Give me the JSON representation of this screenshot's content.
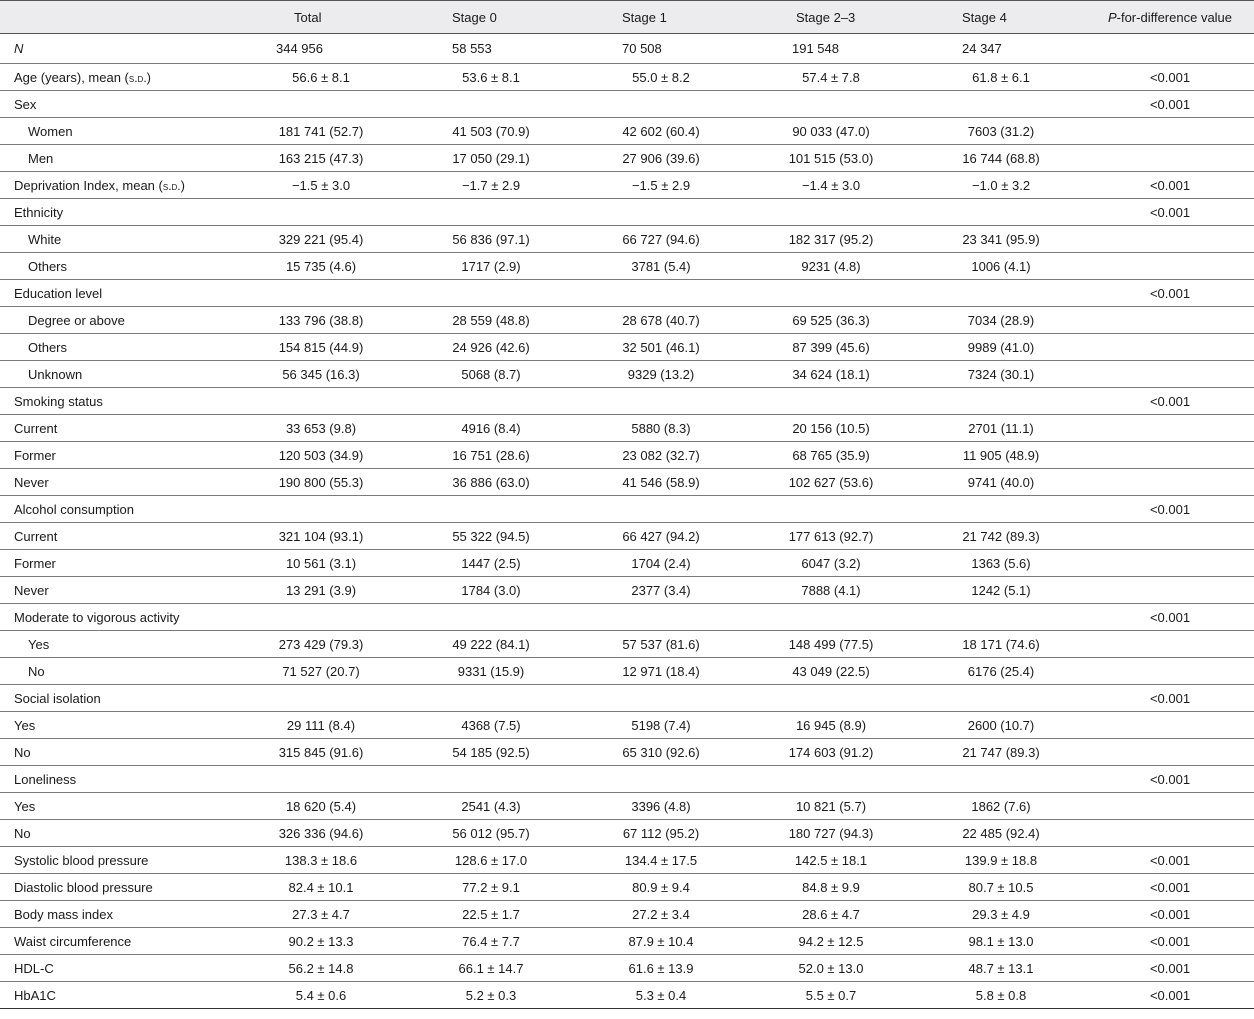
{
  "headers": {
    "col0": "",
    "total": "Total",
    "stage0": "Stage 0",
    "stage1": "Stage 1",
    "stage23": "Stage 2–3",
    "stage4": "Stage 4",
    "p_italic": "P",
    "p_rest": "-for-difference value"
  },
  "n_row": {
    "label": "N",
    "total": "344 956",
    "stage0": "58 553",
    "stage1": "70 508",
    "stage23": "191 548",
    "stage4": "24 347",
    "p": ""
  },
  "age_row": {
    "label_pre": "Age (years), mean (",
    "label_sc": "s.d.",
    "label_post": ")",
    "total": "56.6 ± 8.1",
    "stage0": "53.6 ± 8.1",
    "stage1": "55.0 ± 8.2",
    "stage23": "57.4 ± 7.8",
    "stage4": "61.8 ± 6.1",
    "p": "<0.001"
  },
  "depr_row": {
    "label_pre": "Deprivation Index, mean (",
    "label_sc": "s.d.",
    "label_post": ")",
    "total": "−1.5 ± 3.0",
    "stage0": "−1.7 ± 2.9",
    "stage1": "−1.5 ± 2.9",
    "stage23": "−1.4 ± 3.0",
    "stage4": "−1.0 ± 3.2",
    "p": "<0.001"
  },
  "rows": [
    {
      "label": "Sex",
      "indent": false,
      "total": "",
      "stage0": "",
      "stage1": "",
      "stage23": "",
      "stage4": "",
      "p": "<0.001"
    },
    {
      "label": "Women",
      "indent": true,
      "total": "181 741 (52.7)",
      "stage0": "41 503 (70.9)",
      "stage1": "42 602 (60.4)",
      "stage23": "90 033 (47.0)",
      "stage4": "7603 (31.2)",
      "p": ""
    },
    {
      "label": "Men",
      "indent": true,
      "total": "163 215 (47.3)",
      "stage0": "17 050 (29.1)",
      "stage1": "27 906 (39.6)",
      "stage23": "101 515 (53.0)",
      "stage4": "16 744 (68.8)",
      "p": ""
    },
    {
      "label": "Ethnicity",
      "indent": false,
      "total": "",
      "stage0": "",
      "stage1": "",
      "stage23": "",
      "stage4": "",
      "p": "<0.001"
    },
    {
      "label": "White",
      "indent": true,
      "total": "329 221 (95.4)",
      "stage0": "56 836 (97.1)",
      "stage1": "66 727 (94.6)",
      "stage23": "182 317 (95.2)",
      "stage4": "23 341 (95.9)",
      "p": ""
    },
    {
      "label": "Others",
      "indent": true,
      "total": "15 735 (4.6)",
      "stage0": "1717 (2.9)",
      "stage1": "3781 (5.4)",
      "stage23": "9231 (4.8)",
      "stage4": "1006 (4.1)",
      "p": ""
    },
    {
      "label": "Education level",
      "indent": false,
      "total": "",
      "stage0": "",
      "stage1": "",
      "stage23": "",
      "stage4": "",
      "p": "<0.001"
    },
    {
      "label": "Degree or above",
      "indent": true,
      "total": "133 796 (38.8)",
      "stage0": "28 559 (48.8)",
      "stage1": "28 678 (40.7)",
      "stage23": "69 525 (36.3)",
      "stage4": "7034 (28.9)",
      "p": ""
    },
    {
      "label": "Others",
      "indent": true,
      "total": "154 815 (44.9)",
      "stage0": "24 926 (42.6)",
      "stage1": "32 501 (46.1)",
      "stage23": "87 399 (45.6)",
      "stage4": "9989 (41.0)",
      "p": ""
    },
    {
      "label": "Unknown",
      "indent": true,
      "total": "56 345 (16.3)",
      "stage0": "5068 (8.7)",
      "stage1": "9329 (13.2)",
      "stage23": "34 624 (18.1)",
      "stage4": "7324 (30.1)",
      "p": ""
    },
    {
      "label": "Smoking status",
      "indent": false,
      "total": "",
      "stage0": "",
      "stage1": "",
      "stage23": "",
      "stage4": "",
      "p": "<0.001"
    },
    {
      "label": "Current",
      "indent": false,
      "total": "33 653 (9.8)",
      "stage0": "4916 (8.4)",
      "stage1": "5880 (8.3)",
      "stage23": "20 156 (10.5)",
      "stage4": "2701 (11.1)",
      "p": ""
    },
    {
      "label": "Former",
      "indent": false,
      "total": "120 503 (34.9)",
      "stage0": "16 751 (28.6)",
      "stage1": "23 082 (32.7)",
      "stage23": "68 765 (35.9)",
      "stage4": "11 905 (48.9)",
      "p": ""
    },
    {
      "label": "Never",
      "indent": false,
      "total": "190 800 (55.3)",
      "stage0": "36 886 (63.0)",
      "stage1": "41 546 (58.9)",
      "stage23": "102 627 (53.6)",
      "stage4": "9741 (40.0)",
      "p": ""
    },
    {
      "label": "Alcohol consumption",
      "indent": false,
      "total": "",
      "stage0": "",
      "stage1": "",
      "stage23": "",
      "stage4": "",
      "p": "<0.001"
    },
    {
      "label": "Current",
      "indent": false,
      "total": "321 104 (93.1)",
      "stage0": "55 322 (94.5)",
      "stage1": "66 427 (94.2)",
      "stage23": "177 613 (92.7)",
      "stage4": "21 742 (89.3)",
      "p": ""
    },
    {
      "label": "Former",
      "indent": false,
      "total": "10 561 (3.1)",
      "stage0": "1447 (2.5)",
      "stage1": "1704 (2.4)",
      "stage23": "6047 (3.2)",
      "stage4": "1363 (5.6)",
      "p": ""
    },
    {
      "label": "Never",
      "indent": false,
      "total": "13 291 (3.9)",
      "stage0": "1784 (3.0)",
      "stage1": "2377 (3.4)",
      "stage23": "7888 (4.1)",
      "stage4": "1242 (5.1)",
      "p": ""
    },
    {
      "label": "Moderate to vigorous activity",
      "indent": false,
      "total": "",
      "stage0": "",
      "stage1": "",
      "stage23": "",
      "stage4": "",
      "p": "<0.001"
    },
    {
      "label": "Yes",
      "indent": true,
      "total": "273 429 (79.3)",
      "stage0": "49 222 (84.1)",
      "stage1": "57 537 (81.6)",
      "stage23": "148 499 (77.5)",
      "stage4": "18 171 (74.6)",
      "p": ""
    },
    {
      "label": "No",
      "indent": true,
      "total": "71 527 (20.7)",
      "stage0": "9331 (15.9)",
      "stage1": "12 971 (18.4)",
      "stage23": "43 049 (22.5)",
      "stage4": "6176 (25.4)",
      "p": ""
    },
    {
      "label": "Social isolation",
      "indent": false,
      "total": "",
      "stage0": "",
      "stage1": "",
      "stage23": "",
      "stage4": "",
      "p": "<0.001"
    },
    {
      "label": "Yes",
      "indent": false,
      "total": "29 111 (8.4)",
      "stage0": "4368 (7.5)",
      "stage1": "5198 (7.4)",
      "stage23": "16 945 (8.9)",
      "stage4": "2600 (10.7)",
      "p": ""
    },
    {
      "label": "No",
      "indent": false,
      "total": "315 845 (91.6)",
      "stage0": "54 185 (92.5)",
      "stage1": "65 310 (92.6)",
      "stage23": "174 603 (91.2)",
      "stage4": "21 747 (89.3)",
      "p": ""
    },
    {
      "label": "Loneliness",
      "indent": false,
      "total": "",
      "stage0": "",
      "stage1": "",
      "stage23": "",
      "stage4": "",
      "p": "<0.001"
    },
    {
      "label": "Yes",
      "indent": false,
      "total": "18 620 (5.4)",
      "stage0": "2541 (4.3)",
      "stage1": "3396 (4.8)",
      "stage23": "10 821 (5.7)",
      "stage4": "1862 (7.6)",
      "p": ""
    },
    {
      "label": "No",
      "indent": false,
      "total": "326 336 (94.6)",
      "stage0": "56 012 (95.7)",
      "stage1": "67 112 (95.2)",
      "stage23": "180 727 (94.3)",
      "stage4": "22 485 (92.4)",
      "p": ""
    },
    {
      "label": "Systolic blood pressure",
      "indent": false,
      "total": "138.3 ± 18.6",
      "stage0": "128.6 ± 17.0",
      "stage1": "134.4 ± 17.5",
      "stage23": "142.5 ± 18.1",
      "stage4": "139.9 ± 18.8",
      "p": "<0.001"
    },
    {
      "label": "Diastolic blood pressure",
      "indent": false,
      "total": "82.4 ± 10.1",
      "stage0": "77.2 ± 9.1",
      "stage1": "80.9 ± 9.4",
      "stage23": "84.8 ± 9.9",
      "stage4": "80.7 ± 10.5",
      "p": "<0.001"
    },
    {
      "label": "Body mass index",
      "indent": false,
      "total": "27.3 ± 4.7",
      "stage0": "22.5 ± 1.7",
      "stage1": "27.2 ± 3.4",
      "stage23": "28.6 ± 4.7",
      "stage4": "29.3 ± 4.9",
      "p": "<0.001"
    },
    {
      "label": "Waist circumference",
      "indent": false,
      "total": "90.2 ± 13.3",
      "stage0": "76.4 ± 7.7",
      "stage1": "87.9 ± 10.4",
      "stage23": "94.2 ± 12.5",
      "stage4": "98.1 ± 13.0",
      "p": "<0.001"
    },
    {
      "label": "HDL-C",
      "indent": false,
      "total": "56.2 ± 14.8",
      "stage0": "66.1 ± 14.7",
      "stage1": "61.6 ± 13.9",
      "stage23": "52.0 ± 13.0",
      "stage4": "48.7 ± 13.1",
      "p": "<0.001"
    },
    {
      "label": "HbA1C",
      "indent": false,
      "total": "5.4 ± 0.6",
      "stage0": "5.2 ± 0.3",
      "stage1": "5.3 ± 0.4",
      "stage23": "5.5 ± 0.7",
      "stage4": "5.8 ± 0.8",
      "p": "<0.001"
    }
  ]
}
